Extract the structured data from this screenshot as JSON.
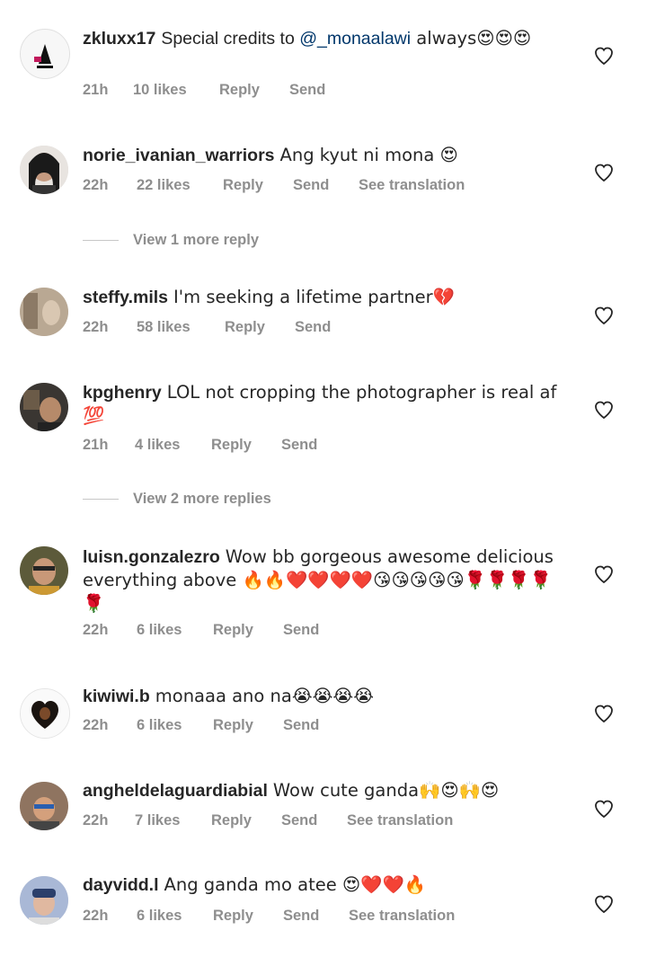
{
  "comments": [
    {
      "username": "zkluxx17",
      "pre_text": "Special credits to ",
      "mention": "@_monaalawi",
      "post_text": " always😍😍😍",
      "time": "21h",
      "likes": "10 likes",
      "reply": "Reply",
      "send": "Send",
      "translate": ""
    },
    {
      "username": "norie_ivanian_warriors",
      "text": "Ang kyut ni mona 😍",
      "time": "22h",
      "likes": "22 likes",
      "reply": "Reply",
      "send": "Send",
      "translate": "See translation"
    },
    {
      "username": "steffy.mils",
      "text": "I'm seeking a lifetime partner💔",
      "time": "22h",
      "likes": "58 likes",
      "reply": "Reply",
      "send": "Send",
      "translate": ""
    },
    {
      "username": "kpghenry",
      "text": "LOL not cropping the photographer is real af 💯",
      "time": "21h",
      "likes": "4 likes",
      "reply": "Reply",
      "send": "Send",
      "translate": ""
    },
    {
      "username": "luisn.gonzalezro",
      "text": "Wow bb gorgeous awesome delicious everything above 🔥🔥❤️❤️❤️❤️😘😘😘😘😘🌹🌹🌹🌹🌹",
      "time": "22h",
      "likes": "6 likes",
      "reply": "Reply",
      "send": "Send",
      "translate": ""
    },
    {
      "username": "kiwiwi.b",
      "text": "monaaa ano na😭😭😭😭",
      "time": "22h",
      "likes": "6 likes",
      "reply": "Reply",
      "send": "Send",
      "translate": ""
    },
    {
      "username": "angheldelaguardiabial",
      "text": "Wow cute ganda🙌😍🙌😍",
      "time": "22h",
      "likes": "7 likes",
      "reply": "Reply",
      "send": "Send",
      "translate": "See translation"
    },
    {
      "username": "dayvidd.l",
      "text": "Ang ganda mo atee 😍❤️❤️🔥",
      "time": "22h",
      "likes": "6 likes",
      "reply": "Reply",
      "send": "Send",
      "translate": "See translation"
    }
  ],
  "view_more": [
    {
      "label": "View 1 more reply"
    },
    {
      "label": "View 2 more replies"
    }
  ],
  "icons": {
    "like": "heart-outline-icon"
  },
  "colors": {
    "username": "#262626",
    "meta": "#8e8e8e",
    "mention": "#00376b"
  }
}
